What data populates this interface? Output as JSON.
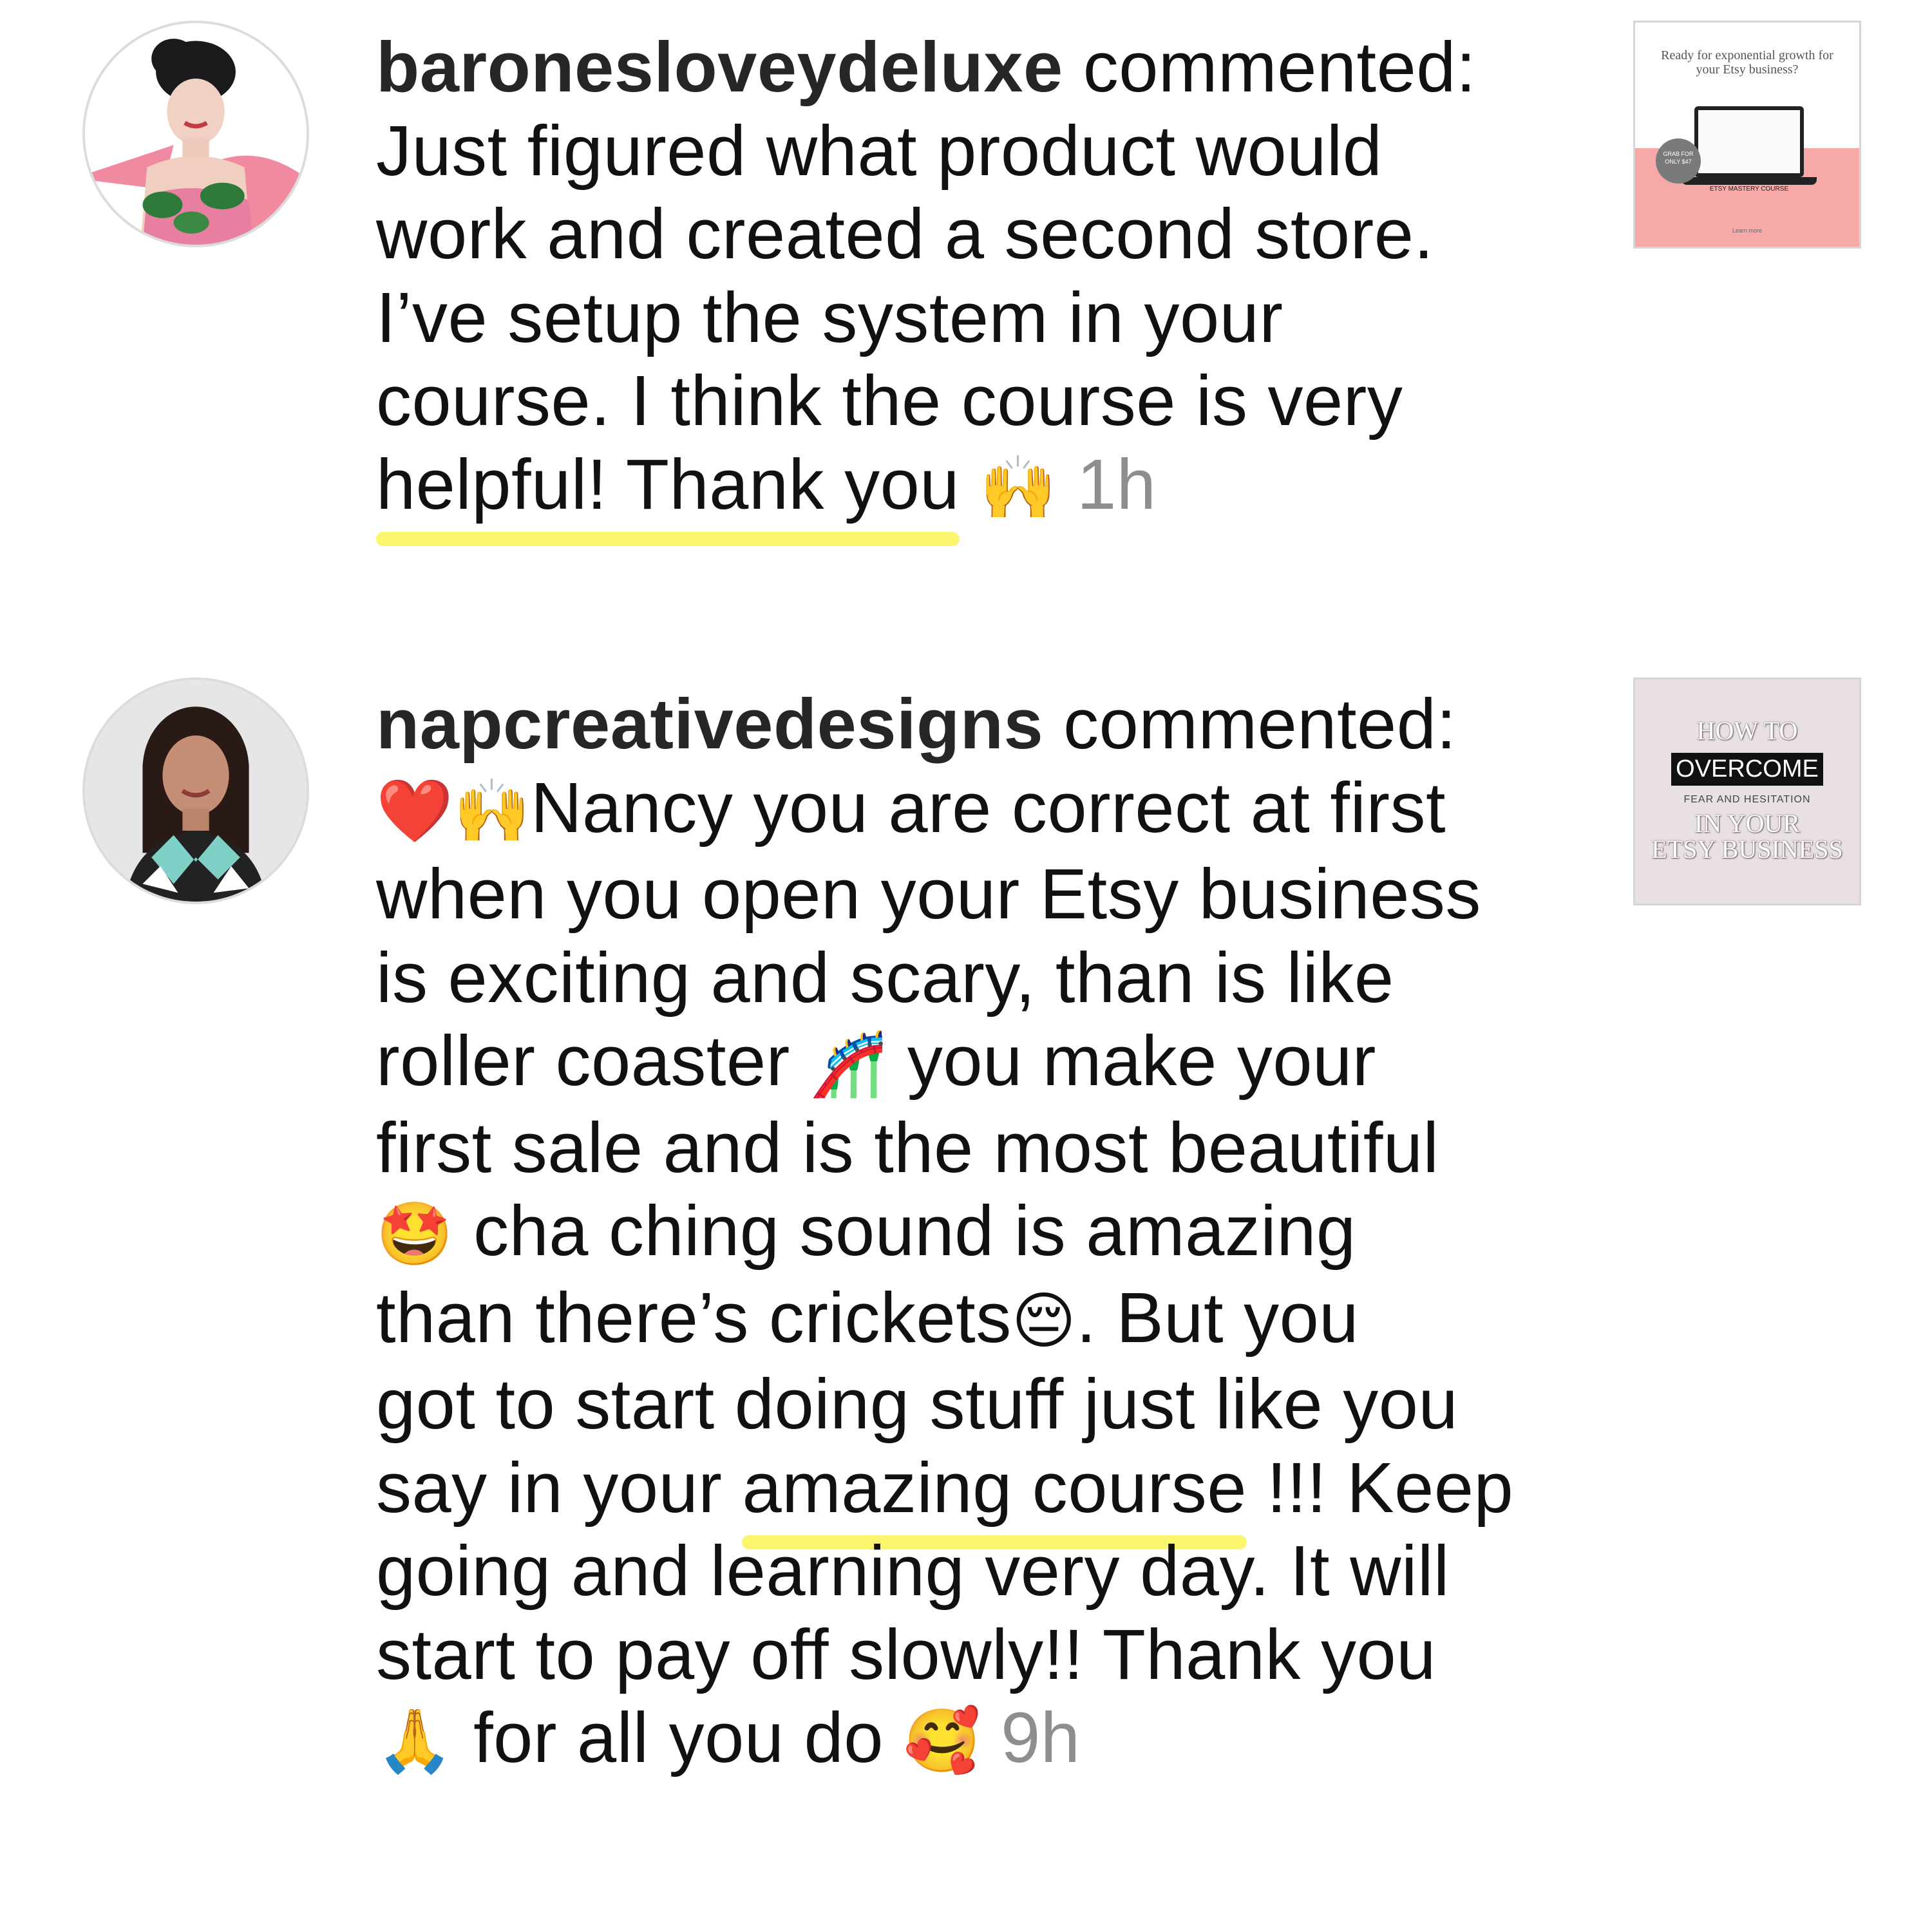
{
  "comments": [
    {
      "username": "baronesloveydeluxe",
      "action": " commented:",
      "lines": [
        "Just figured what product would",
        "work and created a second store.",
        "I’ve setup the system in your",
        "course. I think the course is very"
      ],
      "last_line_highlight": "helpful! Thank you",
      "last_line_emoji": "🙌",
      "time": "1h",
      "thumbnail": {
        "title": "Ready for exponential growth for your Etsy business?",
        "badge": "GRAB FOR ONLY $47",
        "label": "ETSY MASTERY COURSE",
        "footer": "Learn more"
      }
    },
    {
      "username": "napcreativedesigns",
      "action": " commented:",
      "line1_emojis": "❤️🙌",
      "line1_text": "Nancy you are correct at first",
      "line2": "when you open your Etsy business",
      "line3": "is exciting and scary, than is like",
      "line4_a": "roller coaster ",
      "line4_emoji": "🎢",
      "line4_b": " you make your",
      "line5": "first sale and is the most beautiful",
      "line6_emoji": "🤩",
      "line6_text": " cha ching  sound is amazing",
      "line7_a": "than there’s crickets",
      "line7_emoji": "😔",
      "line7_b": ". But you",
      "line8": "got to start doing stuff just like you",
      "line9_a": "say in your ",
      "line9_highlight": "amazing course",
      "line9_b": " !!! Keep",
      "line10": "going and learning very day. It will",
      "line11": "start to pay off slowly!! Thank you",
      "line12_emoji": "🙏",
      "line12_text": " for all you do ",
      "line12_emoji2": "🥰",
      "time": "9h",
      "thumbnail": {
        "line1": "HOW TO",
        "line2": "OVERCOME",
        "line3": "FEAR AND HESITATION",
        "line4": "IN YOUR",
        "line5": "ETSY BUSINESS"
      }
    }
  ],
  "colors": {
    "username": "#262626",
    "timestamp": "#8e8e8e",
    "highlight": "#fbf66d",
    "thumb1_accent": "#f6a9a7",
    "thumb2_bg": "#e8e0e1"
  }
}
